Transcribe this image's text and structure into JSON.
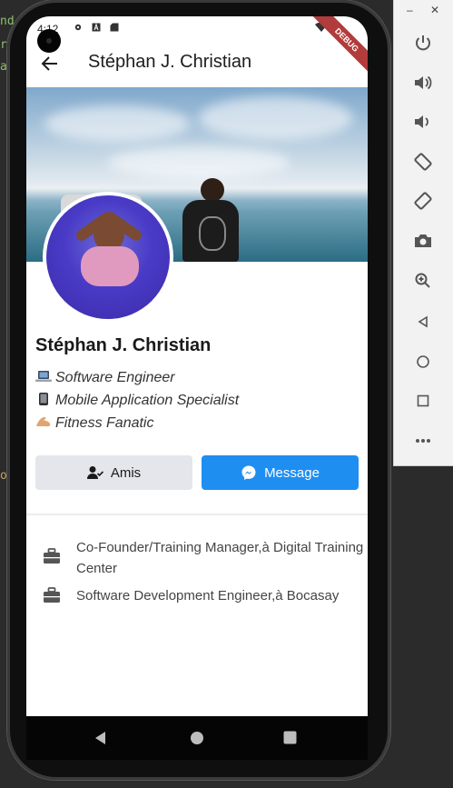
{
  "ide": {
    "snippets": [
      "nd",
      "r",
      "a",
      "o"
    ]
  },
  "status_bar": {
    "time": "4:12"
  },
  "debug_banner": "DEBUG",
  "app_bar": {
    "title": "Stéphan J. Christian"
  },
  "profile": {
    "name": "Stéphan J. Christian",
    "bio": [
      {
        "emoji": "laptop-emoji",
        "text": "Software Engineer"
      },
      {
        "emoji": "mobile-phone-emoji",
        "text": "Mobile Application Specialist"
      },
      {
        "emoji": "flexed-biceps-emoji",
        "text": "Fitness Fanatic"
      }
    ],
    "friends_button_label": "Amis",
    "message_button_label": "Message"
  },
  "work": [
    {
      "icon": "briefcase-icon",
      "text": "Co-Founder/Training Manager,à Digital Training Center"
    },
    {
      "icon": "briefcase-icon",
      "text": "Software Development Engineer,à Bocasay"
    }
  ],
  "colors": {
    "accent_blue": "#1f8ef1",
    "friends_button_bg": "#e4e6eb",
    "debug_ribbon": "#b23b3b"
  }
}
